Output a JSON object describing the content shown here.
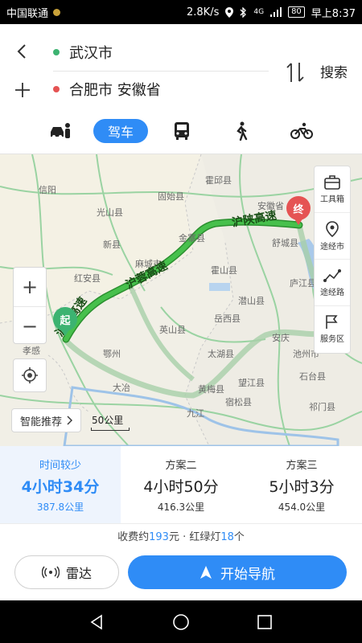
{
  "status_bar": {
    "carrier": "中国联通",
    "speed": "2.8K/s",
    "network": "4G",
    "battery": "80",
    "time": "早上8:37"
  },
  "route": {
    "start": "武汉市",
    "end": "合肥市 安徽省",
    "search_label": "搜索"
  },
  "modes": {
    "drive_label": "驾车"
  },
  "map": {
    "markers": {
      "start": "起",
      "end": "终"
    },
    "road_labels": [
      "沪陕高速",
      "沪蓉高速",
      "沪蓉高速"
    ],
    "place_labels": [
      "信阳",
      "霍邱县",
      "光山县",
      "固始县",
      "安徽省",
      "金寨县",
      "麻城市",
      "新县",
      "红安县",
      "霍山县",
      "庐江县",
      "岳西县",
      "英山县",
      "太湖县",
      "安庆",
      "潜山县",
      "望江县",
      "宿松县",
      "石台县",
      "大冶",
      "黄梅县",
      "九江",
      "孝感",
      "池州市",
      "祁门县",
      "鄂州",
      "舒城县"
    ],
    "tools": [
      "工具箱",
      "途经市",
      "途经路",
      "服务区"
    ],
    "smart_label": "智能推荐",
    "scale": "50公里"
  },
  "options": [
    {
      "name": "时间较少",
      "time": "4小时34分",
      "distance": "387.8公里"
    },
    {
      "name": "方案二",
      "time": "4小时50分",
      "distance": "416.3公里"
    },
    {
      "name": "方案三",
      "time": "5小时3分",
      "distance": "454.0公里"
    }
  ],
  "info": {
    "prefix": "收费约",
    "toll": "193",
    "mid": "元 · 红绿灯",
    "lights": "18",
    "suffix": "个"
  },
  "actions": {
    "radar": "雷达",
    "navigate": "开始导航"
  },
  "colors": {
    "accent": "#2f8cf6",
    "route": "#2fa63a",
    "start": "#3cb371",
    "end": "#e55353"
  }
}
